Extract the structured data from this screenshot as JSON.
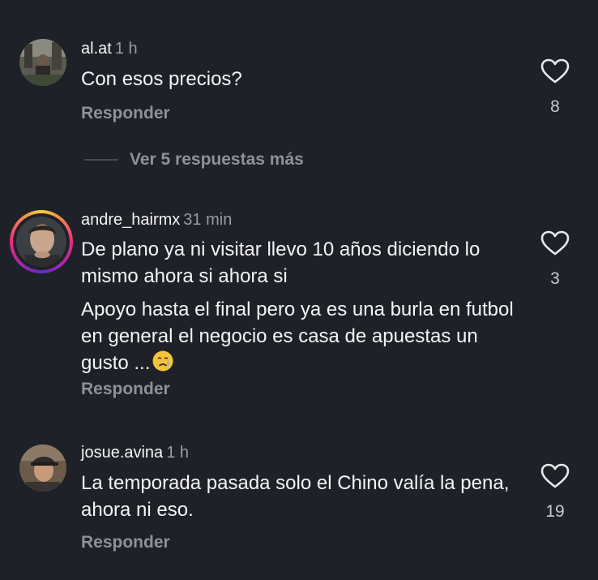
{
  "comments": [
    {
      "username": "al.at",
      "time": "1 h",
      "paragraphs": [
        "Con esos precios?"
      ],
      "reply_label": "Responder",
      "likes": "8",
      "avatar": "photo-person-outdoor"
    },
    {
      "username": "andre_hairmx",
      "time": "31 min",
      "paragraphs": [
        "De plano ya ni visitar llevo 10 años diciendo lo mismo ahora si ahora si",
        "Apoyo hasta el final pero ya es una burla en futbol en general el negocio es casa de apuestas un gusto ..."
      ],
      "emoji": "crying-face-emoji",
      "reply_label": "Responder",
      "likes": "3",
      "avatar": "photo-man-face-story-ring"
    },
    {
      "username": "josue.avina",
      "time": "1 h",
      "paragraphs": [
        "La temporada pasada solo el Chino valía la pena, ahora ni eso."
      ],
      "reply_label": "Responder",
      "likes": "19",
      "avatar": "photo-man-cap"
    }
  ],
  "view_more_replies": "Ver 5 respuestas más",
  "colors": {
    "background": "#1f2128",
    "secondary_text": "#8f9198",
    "story_ring": [
      "#f9ce34",
      "#ee2a7b",
      "#6228d7"
    ]
  },
  "icons": {
    "like": "heart-outline-icon"
  }
}
